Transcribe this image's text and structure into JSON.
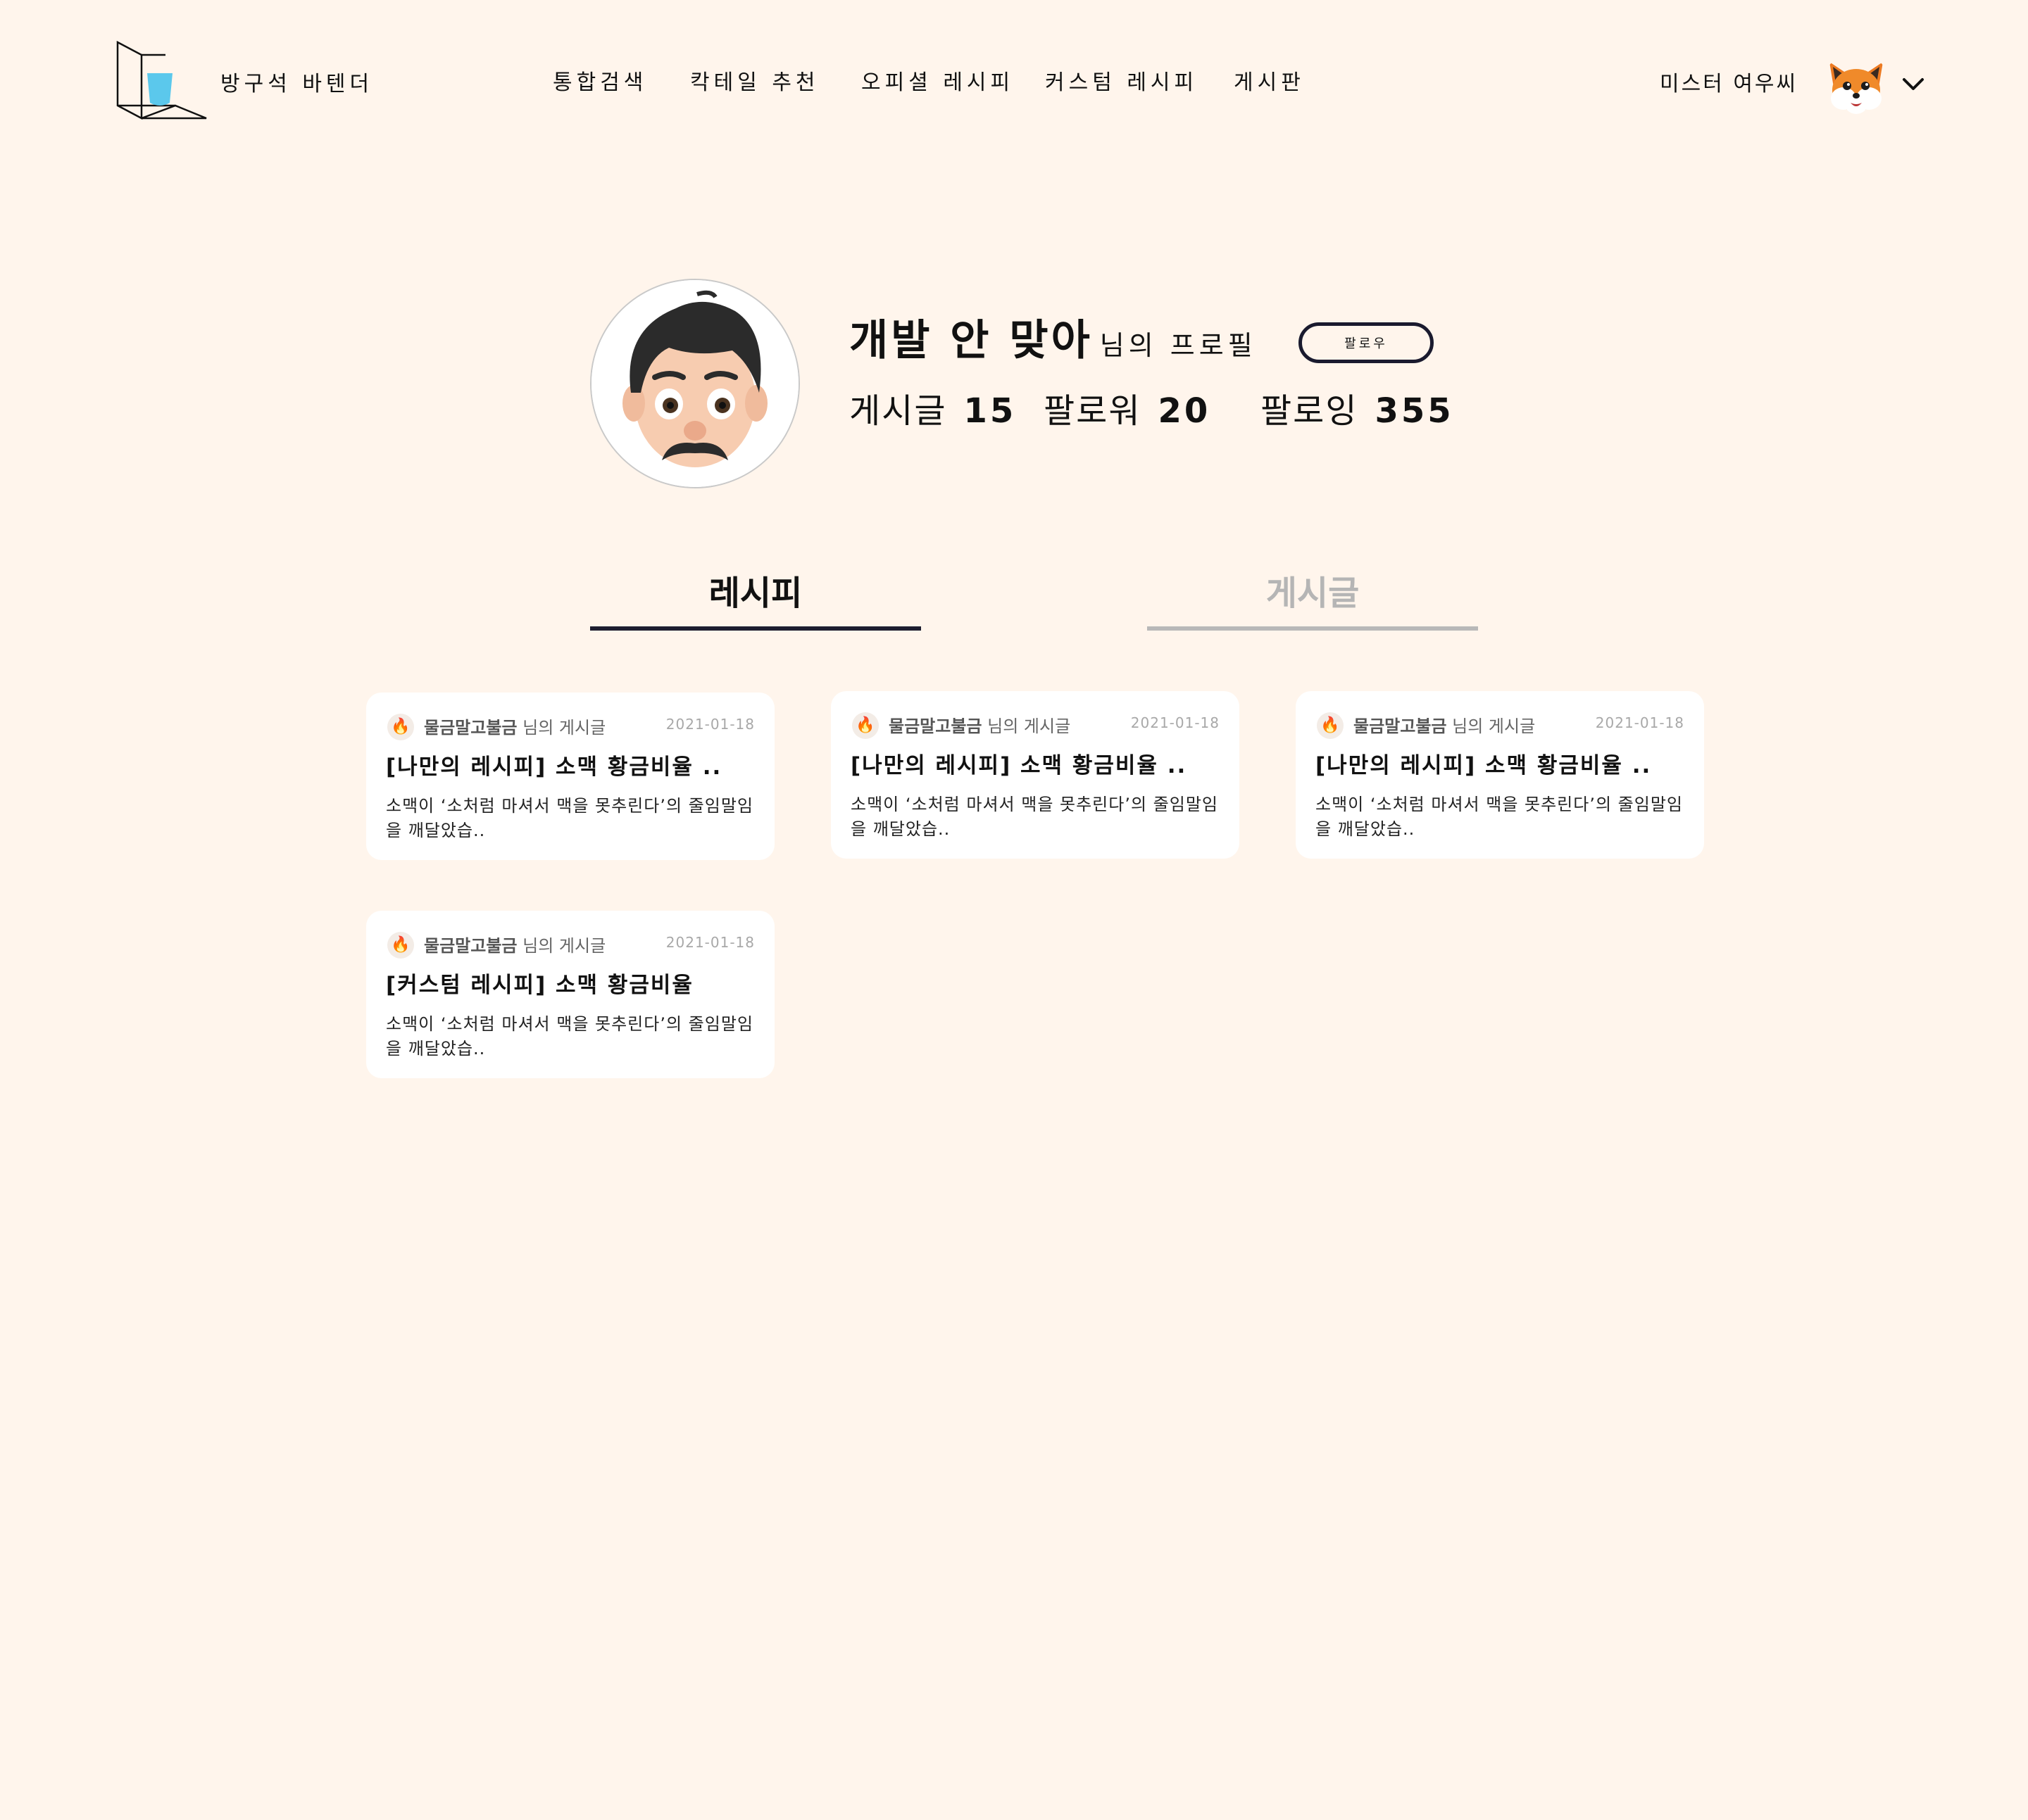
{
  "header": {
    "brand": "방구석 바텐더",
    "nav": [
      "통합검색",
      "칵테일 추천",
      "오피셜 레시피",
      "커스텀 레시피",
      "게시판"
    ],
    "username": "미스터 여우씨"
  },
  "profile": {
    "name": "개발 안 맞아",
    "name_suffix": "님의 프로필",
    "follow_label": "팔로우",
    "stats": {
      "posts_label": "게시글",
      "posts_value": "15",
      "followers_label": "팔로워",
      "followers_value": "20",
      "following_label": "팔로잉",
      "following_value": "355"
    }
  },
  "tabs": [
    {
      "label": "레시피",
      "active": true
    },
    {
      "label": "게시글",
      "active": false
    }
  ],
  "cards": [
    {
      "author": "물금말고불금",
      "author_suffix": "님의 게시글",
      "date": "2021-01-18",
      "title": "[나만의 레시피] 소맥 황금비율 ..",
      "body": "소맥이 ‘소처럼 마셔서 맥을 못추린다’의 줄임말임을 깨달았습.."
    },
    {
      "author": "물금말고불금",
      "author_suffix": "님의 게시글",
      "date": "2021-01-18",
      "title": "[나만의 레시피] 소맥 황금비율 ..",
      "body": "소맥이 ‘소처럼 마셔서 맥을 못추린다’의 줄임말임을 깨달았습.."
    },
    {
      "author": "물금말고불금",
      "author_suffix": "님의 게시글",
      "date": "2021-01-18",
      "title": "[나만의 레시피] 소맥 황금비율 ..",
      "body": "소맥이 ‘소처럼 마셔서 맥을 못추린다’의 줄임말임을 깨달았습.."
    },
    {
      "author": "물금말고불금",
      "author_suffix": "님의 게시글",
      "date": "2021-01-18",
      "title": "[커스텀 레시피] 소맥 황금비율",
      "body": "소맥이 ‘소처럼 마셔서 맥을 못추린다’의 줄임말임을 깨달았습.."
    }
  ],
  "icons": {
    "logo": "cube-glass-logo-icon",
    "user_avatar": "fox-avatar-icon",
    "dropdown": "chevron-down-icon",
    "profile_avatar": "memoji-avatar-icon",
    "card_badge": "fire-icon"
  },
  "colors": {
    "background": "#fff5ec",
    "accent_dark": "#1e1e30",
    "logo_glass": "#5bc8ec",
    "inactive": "#b5b5b5"
  }
}
